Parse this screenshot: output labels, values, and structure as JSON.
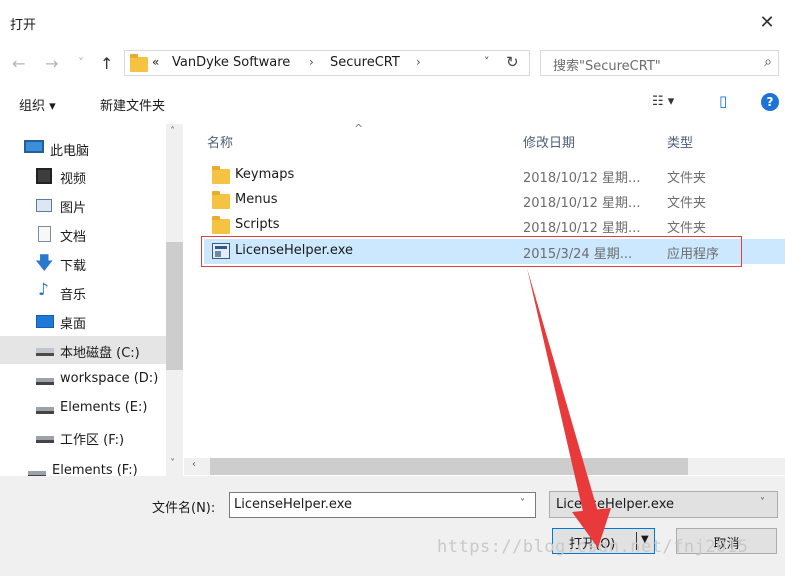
{
  "window": {
    "title": "打开",
    "close_glyph": "✕"
  },
  "nav": {
    "back_glyph": "←",
    "forward_glyph": "→",
    "history_glyph": "˅",
    "up_glyph": "↑",
    "breadcrumb": {
      "overflow": "«",
      "items": [
        "VanDyke Software",
        "SecureCRT"
      ],
      "separator": "›",
      "dropdown_glyph": "˅",
      "refresh_glyph": "↻"
    },
    "search_placeholder": "搜索\"SecureCRT\"",
    "search_glyph": "⌕"
  },
  "commands": {
    "organize": "组织 ▾",
    "new_folder": "新建文件夹",
    "view_glyph": "☷ ▾",
    "pane_glyph": "▯",
    "help": "?"
  },
  "sidebar": {
    "items": [
      {
        "label": "此电脑",
        "icon": "computer-icon"
      },
      {
        "label": "视频",
        "icon": "video-icon"
      },
      {
        "label": "图片",
        "icon": "pictures-icon"
      },
      {
        "label": "文档",
        "icon": "documents-icon"
      },
      {
        "label": "下载",
        "icon": "download-icon"
      },
      {
        "label": "音乐",
        "icon": "music-icon"
      },
      {
        "label": "桌面",
        "icon": "desktop-icon"
      },
      {
        "label": "本地磁盘 (C:)",
        "icon": "local-disk-icon",
        "selected": true
      },
      {
        "label": "workspace (D:)",
        "icon": "drive-icon"
      },
      {
        "label": "Elements (E:)",
        "icon": "drive-icon"
      },
      {
        "label": "工作区 (F:)",
        "icon": "drive-icon"
      },
      {
        "label": "Elements (F:)",
        "icon": "drive-icon"
      }
    ],
    "scroll_up_glyph": "˄",
    "scroll_down_glyph": "˅"
  },
  "filelist": {
    "sort_caret": "^",
    "columns": {
      "name": "名称",
      "date": "修改日期",
      "type": "类型"
    },
    "rows": [
      {
        "name": "Keymaps",
        "date": "2018/10/12 星期...",
        "type": "文件夹",
        "icon": "folder-icon"
      },
      {
        "name": "Menus",
        "date": "2018/10/12 星期...",
        "type": "文件夹",
        "icon": "folder-icon"
      },
      {
        "name": "Scripts",
        "date": "2018/10/12 星期...",
        "type": "文件夹",
        "icon": "folder-icon"
      },
      {
        "name": "LicenseHelper.exe",
        "date": "2015/3/24 星期...",
        "type": "应用程序",
        "icon": "exe-icon",
        "selected": true
      }
    ],
    "hscroll_left_glyph": "‹"
  },
  "footer": {
    "filename_label": "文件名(N):",
    "filename_value": "LicenseHelper.exe",
    "filetype_value": "LicenseHelper.exe",
    "dropdown_glyph": "˅",
    "open_label": "打开(O)",
    "open_split_glyph": "▼",
    "cancel_label": "取消"
  },
  "watermark": "https://blog.csdn.net/fnj2015",
  "colors": {
    "selection": "#cce8ff",
    "highlight_box": "#e43d3d",
    "arrow": "#e83a3a",
    "accent": "#0078d7"
  }
}
